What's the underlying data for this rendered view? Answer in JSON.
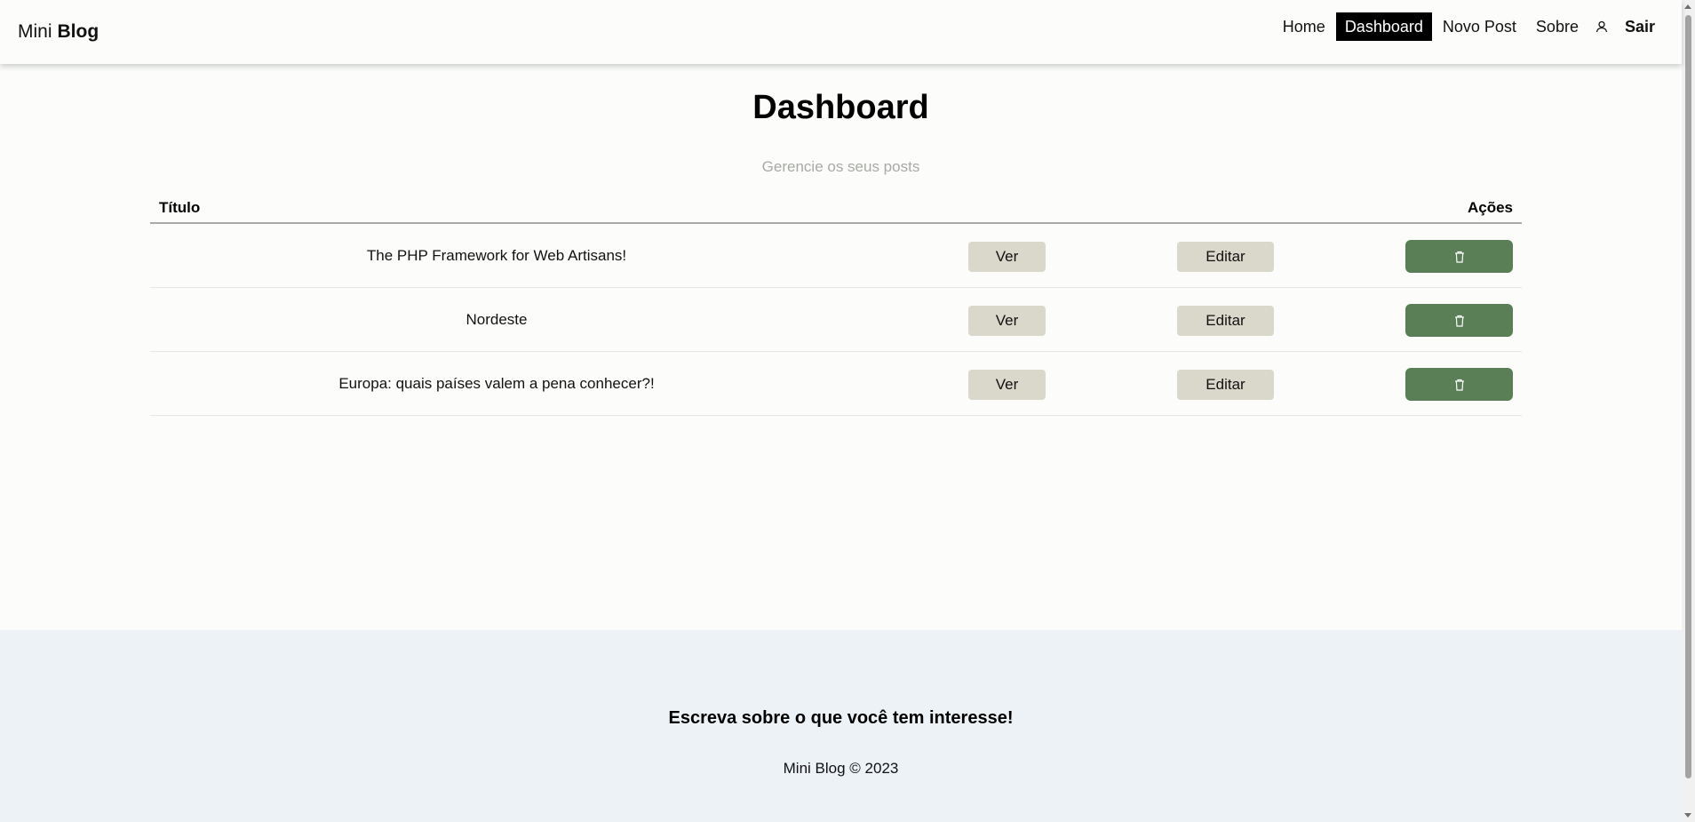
{
  "header": {
    "brand_prefix": "Mini",
    "brand_strong": "Blog",
    "nav": {
      "home": "Home",
      "dashboard": "Dashboard",
      "new_post": "Novo Post",
      "about": "Sobre",
      "logout": "Sair"
    },
    "user_icon": "user-icon"
  },
  "main": {
    "title": "Dashboard",
    "subtitle": "Gerencie os seus posts",
    "table": {
      "col_title": "Título",
      "col_actions": "Ações",
      "rows": [
        {
          "title": "The PHP Framework for Web Artisans!",
          "view": "Ver",
          "edit": "Editar",
          "delete_icon": "trash-icon"
        },
        {
          "title": "Nordeste",
          "view": "Ver",
          "edit": "Editar",
          "delete_icon": "trash-icon"
        },
        {
          "title": "Europa: quais países valem a pena conhecer?!",
          "view": "Ver",
          "edit": "Editar",
          "delete_icon": "trash-icon"
        }
      ]
    }
  },
  "footer": {
    "tagline": "Escreva sobre o que você tem interesse!",
    "copyright": "Mini Blog © 2023"
  },
  "colors": {
    "background": "#fcfdfb",
    "active_nav": "#000000",
    "neutral_button": "#dad7cb",
    "delete_button": "#5a7f57",
    "footer_bg": "#edf2f6"
  }
}
